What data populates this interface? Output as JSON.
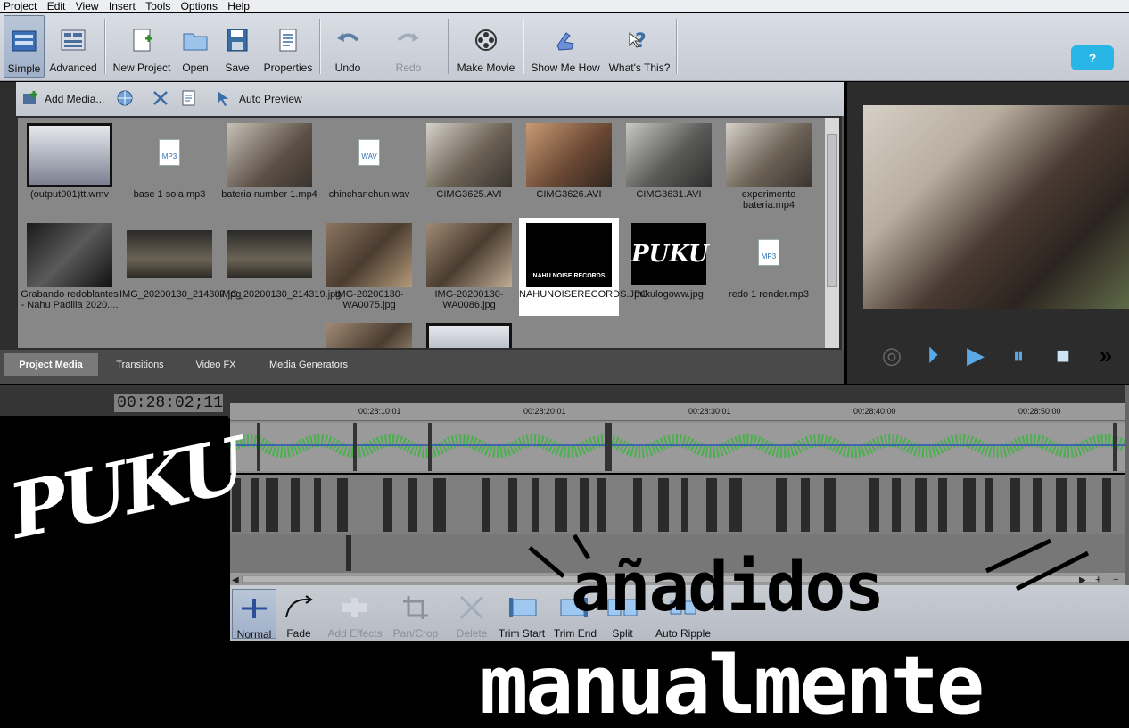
{
  "menu": [
    "Project",
    "Edit",
    "View",
    "Insert",
    "Tools",
    "Options",
    "Help"
  ],
  "toolbar": {
    "simple": "Simple",
    "advanced": "Advanced",
    "new_project": "New Project",
    "open": "Open",
    "save": "Save",
    "properties": "Properties",
    "undo": "Undo",
    "redo": "Redo",
    "make_movie": "Make Movie",
    "show_me_how": "Show Me How",
    "whats_this": "What's This?",
    "help": "?"
  },
  "media_toolbar": {
    "add_media": "Add Media...",
    "auto_preview": "Auto Preview"
  },
  "media_items": [
    {
      "name": "(output001)tt.wmv",
      "type": "video"
    },
    {
      "name": "base 1 sola.mp3",
      "type": "MP3"
    },
    {
      "name": "bateria number 1.mp4",
      "type": "video"
    },
    {
      "name": "chinchanchun.wav",
      "type": "WAV"
    },
    {
      "name": "CIMG3625.AVI",
      "type": "video"
    },
    {
      "name": "CIMG3626.AVI",
      "type": "video"
    },
    {
      "name": "CIMG3631.AVI",
      "type": "video"
    },
    {
      "name": "experimento bateria.mp4",
      "type": "video"
    },
    {
      "name": "Grabando redoblantes - Nahu Padilla 2020....",
      "type": "video"
    },
    {
      "name": "IMG_20200130_214307.jpg",
      "type": "image"
    },
    {
      "name": "IMG_20200130_214319.jpg",
      "type": "image"
    },
    {
      "name": "IMG-20200130-WA0075.jpg",
      "type": "image"
    },
    {
      "name": "IMG-20200130-WA0086.jpg",
      "type": "image"
    },
    {
      "name": "NAHUNOISERECORDS.JPG",
      "type": "image",
      "selected": true,
      "thumb_text": "NAHU NOISE RECORDS"
    },
    {
      "name": "pukulogoww.jpg",
      "type": "image",
      "thumb_text": "PUKU"
    },
    {
      "name": "redo 1 render.mp3",
      "type": "MP3"
    }
  ],
  "media_tabs": [
    "Project Media",
    "Transitions",
    "Video FX",
    "Media Generators"
  ],
  "timeline": {
    "timecode": "00:28:02;11",
    "ruler": [
      "00:28:10;01",
      "00:28:20;01",
      "00:28:30;01",
      "00:28:40;00",
      "00:28:50;00"
    ]
  },
  "edit_toolbar": {
    "normal": "Normal",
    "fade": "Fade",
    "add_effects": "Add Effects",
    "pan_crop": "Pan/Crop",
    "delete": "Delete",
    "trim_start": "Trim Start",
    "trim_end": "Trim End",
    "split": "Split",
    "auto_ripple": "Auto Ripple"
  },
  "overlay": {
    "logo": "PUKU",
    "caption_top": "añadidos",
    "caption_bottom": "manualmente"
  },
  "colors": {
    "accent": "#27b6e6",
    "waveform": "#4caf50",
    "playback_icons": "#5aa8e6"
  }
}
